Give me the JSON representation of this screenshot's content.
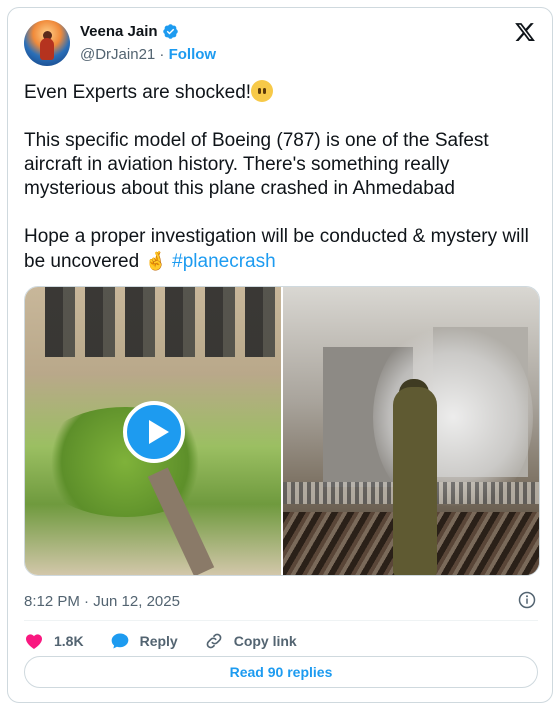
{
  "author": {
    "name": "Veena Jain",
    "handle": "@DrJain21",
    "separator": " · ",
    "follow_label": "Follow"
  },
  "tweet": {
    "line1": "Even Experts are shocked!",
    "line2": "This specific model of Boeing (787) is one of the Safest aircraft in aviation history. There's something really mysterious about this plane crashed in Ahmedabad",
    "line3": "Hope a proper investigation will be conducted & mystery will be uncovered",
    "hashtag": "#planecrash",
    "emoji1": "face-without-mouth-emoji",
    "emoji2": "crossed-fingers-emoji"
  },
  "timestamp": "8:12 PM · Jun 12, 2025",
  "actions": {
    "likes_count": "1.8K",
    "reply_label": "Reply",
    "copy_link_label": "Copy link"
  },
  "read_replies_label": "Read 90 replies",
  "colors": {
    "accent": "#1d9bf0",
    "like": "#f91880",
    "text": "#0f1419",
    "secondary": "#536471"
  }
}
